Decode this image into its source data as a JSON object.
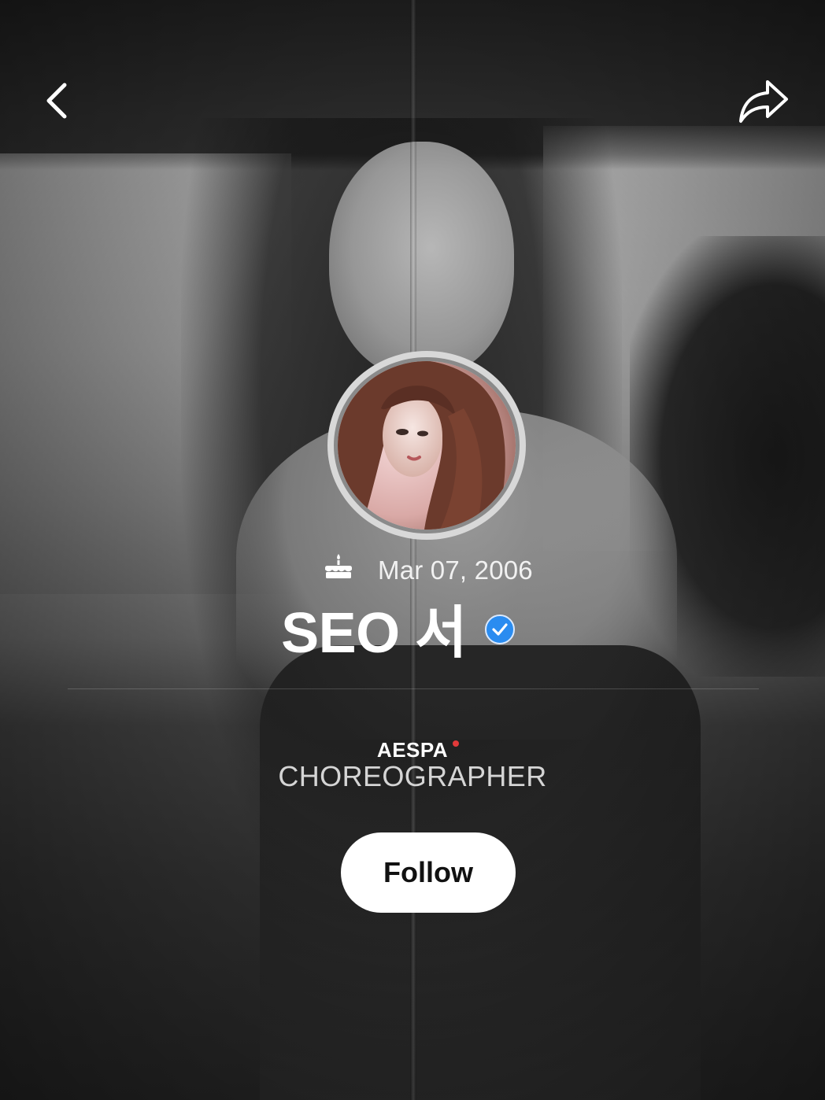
{
  "nav": {
    "back_icon": "chevron-left-icon",
    "share_icon": "share-arrow-icon"
  },
  "profile": {
    "birthday_icon": "birthday-cake-icon",
    "birthday": "Mar 07, 2006",
    "name": "SEO 서",
    "verified_icon": "verified-badge-icon",
    "verified_color": "#2a8cf0",
    "group": "AESPA",
    "group_status_color": "#e23a3a",
    "role": "CHOREOGRAPHER"
  },
  "actions": {
    "follow_label": "Follow"
  }
}
